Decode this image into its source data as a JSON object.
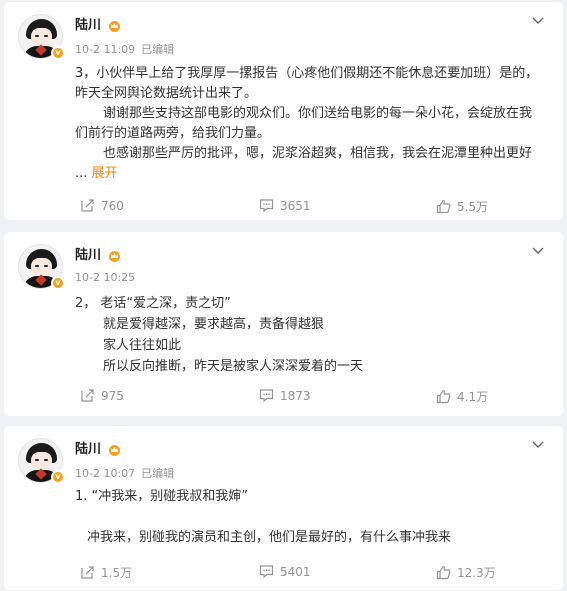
{
  "posts": [
    {
      "author": "陆川",
      "avatar_badge": "v",
      "time": "10-2 11:09",
      "edited_label": "已编辑",
      "body": [
        "3，小伙伴早上给了我厚厚一摞报告（心疼他们假期还不能休息还要加班）是的，昨天全网舆论数据统计出来了。",
        "谢谢那些支持这部电影的观众们。你们送给电影的每一朵小花，会绽放在我们前行的道路两旁，给我们力量。",
        "也感谢那些严厉的批评，嗯，泥浆浴超爽，相信我，我会在泥潭里种出更好"
      ],
      "ellipsis": "...",
      "expand_label": "展开",
      "reposts": "760",
      "comments": "3651",
      "likes": "5.5万"
    },
    {
      "author": "陆川",
      "avatar_badge": "v",
      "time": "10-2 10:25",
      "edited_label": "",
      "body": [
        "2，  老话“爱之深，责之切”",
        "就是爱得越深，要求越高，责备得越狠",
        "家人往往如此",
        "所以反向推断，昨天是被家人深深爱着的一天"
      ],
      "reposts": "975",
      "comments": "1873",
      "likes": "4.1万"
    },
    {
      "author": "陆川",
      "avatar_badge": "v",
      "time": "10-2 10:07",
      "edited_label": "已编辑",
      "body": [
        "1. “冲我来，别碰我叔和我婶”",
        "冲我来，别碰我的演员和主创，他们是最好的，有什么事冲我来"
      ],
      "reposts": "1.5万",
      "comments": "5401",
      "likes": "12.3万"
    }
  ],
  "icons": {
    "repost": "repost-icon",
    "comment": "comment-icon",
    "like": "thumbs-up-icon",
    "more": "chevron-down-icon",
    "crown": "crown-icon"
  },
  "colors": {
    "accent": "#ff8200",
    "crown": "#f6a01a",
    "meta": "#939393"
  }
}
